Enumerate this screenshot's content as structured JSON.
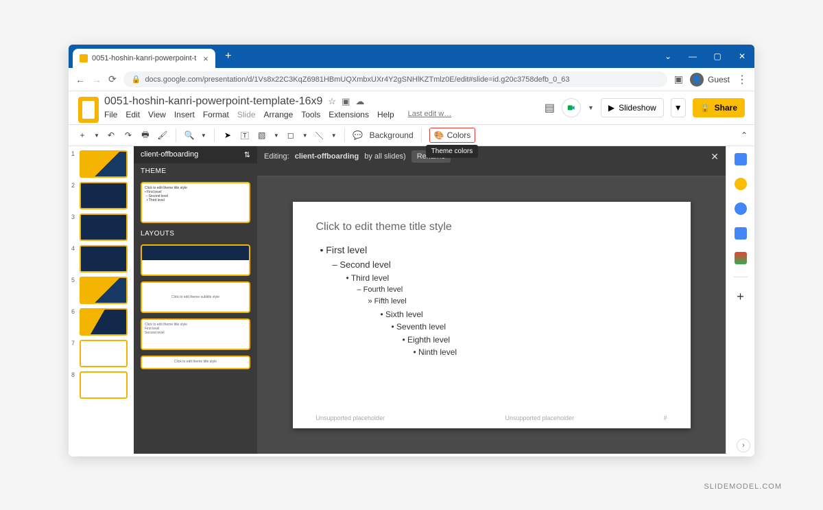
{
  "browser": {
    "tab_title": "0051-hoshin-kanri-powerpoint-t",
    "url": "docs.google.com/presentation/d/1Vs8x22C3KqZ6981HBmUQXmbxUXr4Y2gSNHlKZTmlz0E/edit#slide=id.g20c3758defb_0_63",
    "guest_label": "Guest"
  },
  "doc": {
    "title": "0051-hoshin-kanri-powerpoint-template-16x9",
    "last_edit": "Last edit w…",
    "menus": [
      "File",
      "Edit",
      "View",
      "Insert",
      "Format",
      "Slide",
      "Arrange",
      "Tools",
      "Extensions",
      "Help"
    ],
    "slideshow": "Slideshow",
    "share": "Share"
  },
  "toolbar": {
    "background": "Background",
    "colors": "Colors",
    "tooltip": "Theme colors"
  },
  "theme_panel": {
    "name": "client-offboarding",
    "theme_label": "THEME",
    "layouts_label": "LAYOUTS"
  },
  "editor": {
    "prefix": "Editing:",
    "name": "client-offboarding",
    "suffix": "by all slides)",
    "rename": "Rename"
  },
  "slide": {
    "title": "Click to edit theme title style",
    "l1": "• First level",
    "l2": "– Second level",
    "l3": "• Third level",
    "l4": "– Fourth level",
    "l5": "» Fifth level",
    "l6": "• Sixth level",
    "l7": "• Seventh level",
    "l8": "• Eighth level",
    "l9": "• Ninth level",
    "ph": "Unsupported placeholder",
    "pagenum": "#"
  },
  "thumbs": [
    "1",
    "2",
    "3",
    "4",
    "5",
    "6",
    "7",
    "8"
  ],
  "watermark": "SLIDEMODEL.COM"
}
